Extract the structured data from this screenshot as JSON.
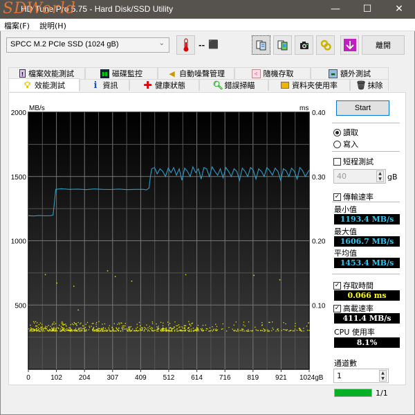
{
  "window": {
    "title": "HD Tune Pro 5.75 - Hard Disk/SSD Utility",
    "watermark": "SDWorld",
    "minimize": "—",
    "maximize": "☐",
    "close": "✕"
  },
  "menu": [
    {
      "label": "檔案(F)"
    },
    {
      "label": "說明(H)"
    }
  ],
  "toolbar": {
    "drive": "SPCC M.2 PCIe SSD (1024 gB)",
    "temperature": "--",
    "buttons": [
      {
        "icon": "copy-info-icon"
      },
      {
        "icon": "copy-screenshot-icon"
      },
      {
        "icon": "camera-icon"
      },
      {
        "icon": "options-icon"
      },
      {
        "icon": "download-icon"
      }
    ],
    "exit_label": "離開"
  },
  "tabs_top": [
    {
      "label": "檔案效能測試",
      "icon": "file-benchmark-icon"
    },
    {
      "label": "磁碟監控",
      "icon": "disk-monitor-icon"
    },
    {
      "label": "自動噪聲管理",
      "icon": "speaker-icon"
    },
    {
      "label": "隨機存取",
      "icon": "random-access-icon"
    },
    {
      "label": "額外測試",
      "icon": "extra-tests-icon"
    }
  ],
  "tabs_bottom": [
    {
      "label": "效能測試",
      "icon": "bulb-icon",
      "active": true
    },
    {
      "label": "資訊",
      "icon": "info-icon"
    },
    {
      "label": "健康狀態",
      "icon": "health-cross-icon"
    },
    {
      "label": "錯誤掃瞄",
      "icon": "magnifier-icon"
    },
    {
      "label": "資料夾使用率",
      "icon": "folder-icon"
    },
    {
      "label": "抹除",
      "icon": "trash-icon"
    }
  ],
  "side": {
    "start_label": "Start",
    "read_label": "讀取",
    "write_label": "寫入",
    "read_selected": true,
    "short_test_label": "短程測試",
    "short_test_checked": false,
    "short_test_value": "40",
    "short_test_unit": "gB",
    "transfer_rate_label": "傳輸速率",
    "transfer_rate_checked": true,
    "min_label": "最小值",
    "min_value": "1193.4 MB/s",
    "max_label": "最大值",
    "max_value": "1606.7 MB/s",
    "avg_label": "平均值",
    "avg_value": "1453.4 MB/s",
    "access_time_label": "存取時間",
    "access_time_checked": true,
    "access_time_value": "0.066 ms",
    "burst_rate_label": "高載速率",
    "burst_rate_checked": true,
    "burst_rate_value": "411.4 MB/s",
    "cpu_label": "CPU 使用率",
    "cpu_value": "8.1%",
    "threads_label": "通道數",
    "threads_value": "1",
    "progress_fraction": 1.0,
    "progress_text": "1/1",
    "colors": {
      "transfer": "#2fc8f0",
      "access": "#ffff00",
      "burst": "#ffffff",
      "cpu": "#ffffff",
      "progress": "#06b025"
    }
  },
  "chart_data": {
    "type": "line",
    "title": "",
    "ylabel_left": "MB/s",
    "ylabel_right": "ms",
    "xlabel": "gB",
    "xlim": [
      0,
      1024
    ],
    "ylim_left": [
      0,
      2000
    ],
    "ylim_right": [
      0,
      0.4
    ],
    "x_ticks": [
      "0",
      "102",
      "204",
      "307",
      "409",
      "512",
      "614",
      "716",
      "819",
      "921",
      "1024gB"
    ],
    "y_ticks_left": [
      "2000",
      "1500",
      "1000",
      "500"
    ],
    "y_ticks_right": [
      "0.40",
      "0.30",
      "0.20",
      "0.10"
    ],
    "grid": true,
    "series": [
      {
        "name": "Transfer rate (MB/s)",
        "color": "#2a9fc8",
        "x": [
          0,
          20,
          40,
          60,
          80,
          90,
          95,
          100,
          120,
          150,
          180,
          210,
          240,
          270,
          300,
          330,
          360,
          390,
          420,
          430,
          440,
          445,
          450,
          460,
          470,
          480,
          490,
          500,
          510,
          520,
          530,
          540,
          550,
          560,
          570,
          580,
          590,
          600,
          610,
          620,
          630,
          640,
          650,
          660,
          670,
          680,
          690,
          700,
          710,
          720,
          730,
          740,
          750,
          760,
          770,
          780,
          790,
          800,
          810,
          820,
          830,
          840,
          850,
          860,
          870,
          880,
          890,
          900,
          910,
          920,
          930,
          940,
          950,
          960,
          970,
          980,
          990,
          1000,
          1010,
          1024
        ],
        "values": [
          1195,
          1193,
          1196,
          1194,
          1195,
          1200,
          1300,
          1400,
          1405,
          1400,
          1402,
          1398,
          1403,
          1400,
          1399,
          1402,
          1398,
          1400,
          1400,
          1395,
          1410,
          1500,
          1560,
          1570,
          1520,
          1560,
          1540,
          1500,
          1565,
          1530,
          1570,
          1510,
          1560,
          1470,
          1565,
          1540,
          1500,
          1575,
          1530,
          1560,
          1480,
          1570,
          1560,
          1500,
          1575,
          1540,
          1510,
          1560,
          1490,
          1570,
          1540,
          1500,
          1560,
          1540,
          1470,
          1565,
          1540,
          1500,
          1570,
          1550,
          1480,
          1560,
          1540,
          1500,
          1570,
          1545,
          1510,
          1565,
          1540,
          1470,
          1560,
          1545,
          1500,
          1565,
          1540,
          1480,
          1570,
          1545,
          1500,
          1550
        ]
      },
      {
        "name": "Access time (ms)",
        "type": "scatter",
        "color": "#e8e800",
        "axis": "right",
        "band_ms": [
          0.06,
          0.075
        ],
        "outliers": [
          [
            60,
            0.148
          ],
          [
            102,
            0.135
          ],
          [
            164,
            0.13
          ],
          [
            180,
            0.093
          ],
          [
            287,
            0.154
          ],
          [
            315,
            0.145
          ],
          [
            375,
            0.138
          ],
          [
            572,
            0.148
          ],
          [
            821,
            0.147
          ],
          [
            915,
            0.14
          ],
          [
            1020,
            0.073
          ]
        ]
      }
    ]
  }
}
